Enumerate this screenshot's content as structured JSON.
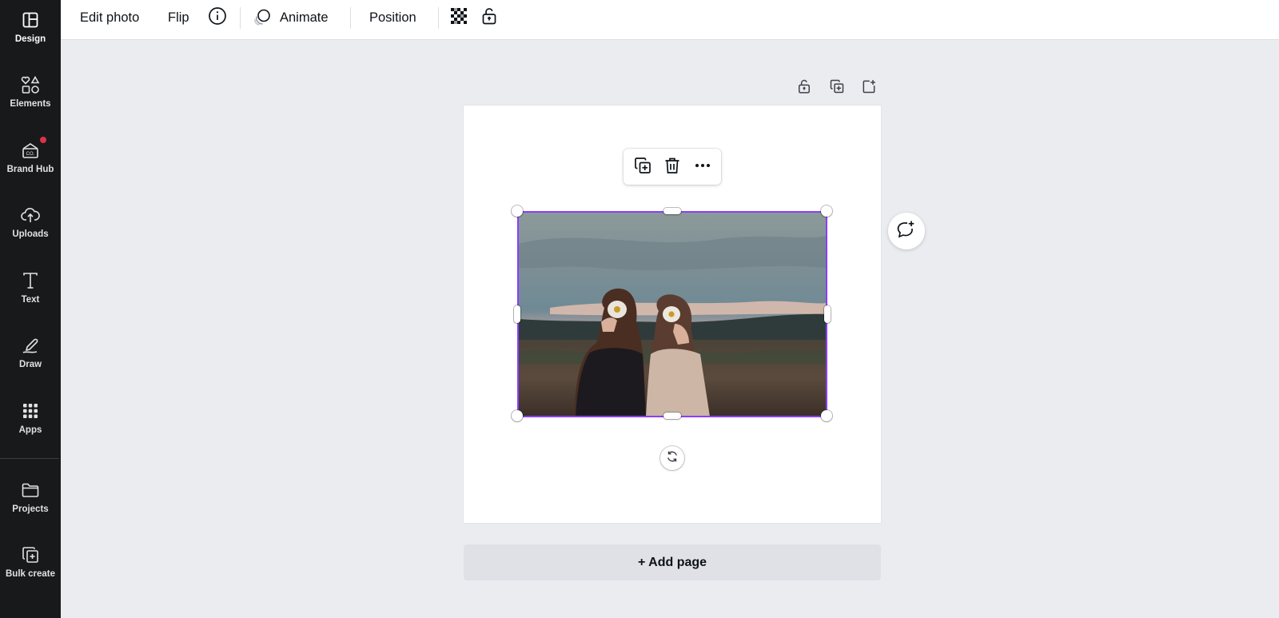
{
  "sidebar": {
    "items": [
      {
        "label": "Design",
        "icon": "layout-icon"
      },
      {
        "label": "Elements",
        "icon": "shapes-icon"
      },
      {
        "label": "Brand Hub",
        "icon": "brand-icon"
      },
      {
        "label": "Uploads",
        "icon": "cloud-upload-icon"
      },
      {
        "label": "Text",
        "icon": "text-icon"
      },
      {
        "label": "Draw",
        "icon": "pen-icon"
      },
      {
        "label": "Apps",
        "icon": "grid-icon"
      },
      {
        "label": "Projects",
        "icon": "folder-icon"
      },
      {
        "label": "Bulk create",
        "icon": "bulk-create-icon"
      }
    ]
  },
  "toolbar": {
    "edit_photo": "Edit photo",
    "flip": "Flip",
    "animate": "Animate",
    "position": "Position"
  },
  "canvas": {
    "add_page": "+ Add page"
  },
  "colors": {
    "selection": "#8b3dff",
    "sidebar_bg": "#18191b",
    "canvas_bg": "#ebecf0",
    "notification": "#e0314b"
  }
}
